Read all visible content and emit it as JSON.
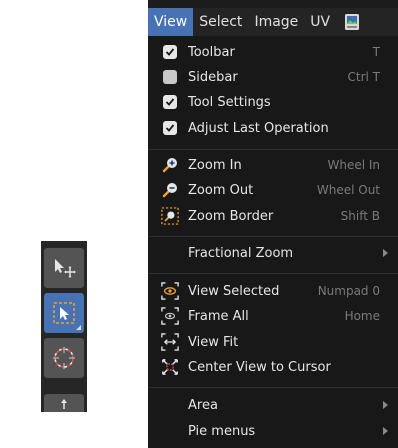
{
  "menubar": {
    "items": [
      "View",
      "Select",
      "Image",
      "UV"
    ],
    "active": "View",
    "icon": "image-editor-icon"
  },
  "view_menu": {
    "group1": [
      {
        "label": "Toolbar",
        "shortcut": "T",
        "checked": true
      },
      {
        "label": "Sidebar",
        "shortcut": "Ctrl T",
        "checked": false
      },
      {
        "label": "Tool Settings",
        "shortcut": "",
        "checked": true
      },
      {
        "label": "Adjust Last Operation",
        "shortcut": "",
        "checked": true
      }
    ],
    "group2": [
      {
        "label": "Zoom In",
        "shortcut": "Wheel In",
        "icon": "zoom-in-icon"
      },
      {
        "label": "Zoom Out",
        "shortcut": "Wheel Out",
        "icon": "zoom-out-icon"
      },
      {
        "label": "Zoom Border",
        "shortcut": "Shift B",
        "icon": "zoom-border-icon"
      }
    ],
    "group3": [
      {
        "label": "Fractional Zoom",
        "submenu": true
      }
    ],
    "group4": [
      {
        "label": "View Selected",
        "shortcut": "Numpad 0",
        "icon": "view-selected-icon"
      },
      {
        "label": "Frame All",
        "shortcut": "Home",
        "icon": "frame-all-icon"
      },
      {
        "label": "View Fit",
        "shortcut": "",
        "icon": "view-fit-icon"
      },
      {
        "label": "Center View to Cursor",
        "shortcut": "",
        "icon": "center-cursor-icon"
      }
    ],
    "group5": [
      {
        "label": "Area",
        "submenu": true
      },
      {
        "label": "Pie menus",
        "submenu": true
      }
    ]
  },
  "toolbar": {
    "tools": [
      {
        "name": "move-tool",
        "icon": "move-icon",
        "active": false
      },
      {
        "name": "select-box-tool",
        "icon": "select-box-icon",
        "active": true
      },
      {
        "name": "cursor-tool",
        "icon": "cursor-icon",
        "active": false
      },
      {
        "name": "transform-tool",
        "icon": "transform-icon",
        "active": false
      }
    ]
  },
  "colors": {
    "accent": "#4772b3",
    "menu_bg": "#181818",
    "text": "#e6e6e6",
    "shortcut": "#7a7a7a"
  }
}
